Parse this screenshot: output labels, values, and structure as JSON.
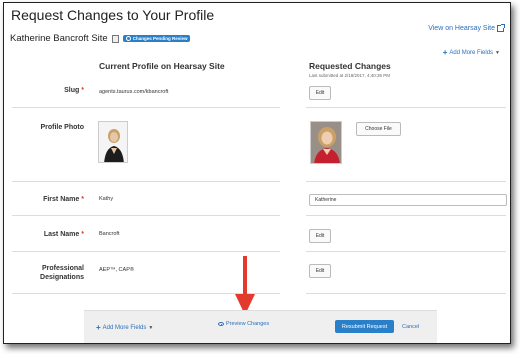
{
  "page": {
    "title": "Request Changes to Your Profile",
    "view_link": "View on Hearsay Site",
    "site_name": "Katherine Bancroft Site",
    "pending_badge": "Changes Pending Review",
    "add_more_fields": "Add More Fields"
  },
  "columns": {
    "current": "Current Profile on Hearsay Site",
    "requested": "Requested Changes",
    "submitted_note": "Last submitted at 2/18/2017, 4:40:36 PM"
  },
  "fields": {
    "slug": {
      "label": "Slug",
      "required": "*",
      "current": "agents.taurus.com/kbancroft",
      "action": "Edit"
    },
    "photo": {
      "label": "Profile Photo",
      "action": "Choose File"
    },
    "first_name": {
      "label": "First Name",
      "required": "*",
      "current": "Kathy",
      "requested": "Katherine"
    },
    "last_name": {
      "label": "Last Name",
      "required": "*",
      "current": "Bancroft",
      "action": "Edit"
    },
    "designations": {
      "label": "Professional Designations",
      "current": "AEP™, CAP®",
      "action": "Edit"
    }
  },
  "footer": {
    "add_more_fields": "Add More Fields",
    "preview": "Preview Changes",
    "resubmit": "Resubmit Request",
    "cancel": "Cancel"
  },
  "icons": {
    "view_link": "external-link-icon",
    "site": "document-icon",
    "badge": "refresh-icon",
    "add": "plus-icon",
    "preview": "eye-icon",
    "annotation": "red-arrow-icon"
  },
  "colors": {
    "accent": "#2a7fc9",
    "link": "#2a6ebb",
    "required": "#dd3333",
    "arrow": "#e23b2e"
  }
}
